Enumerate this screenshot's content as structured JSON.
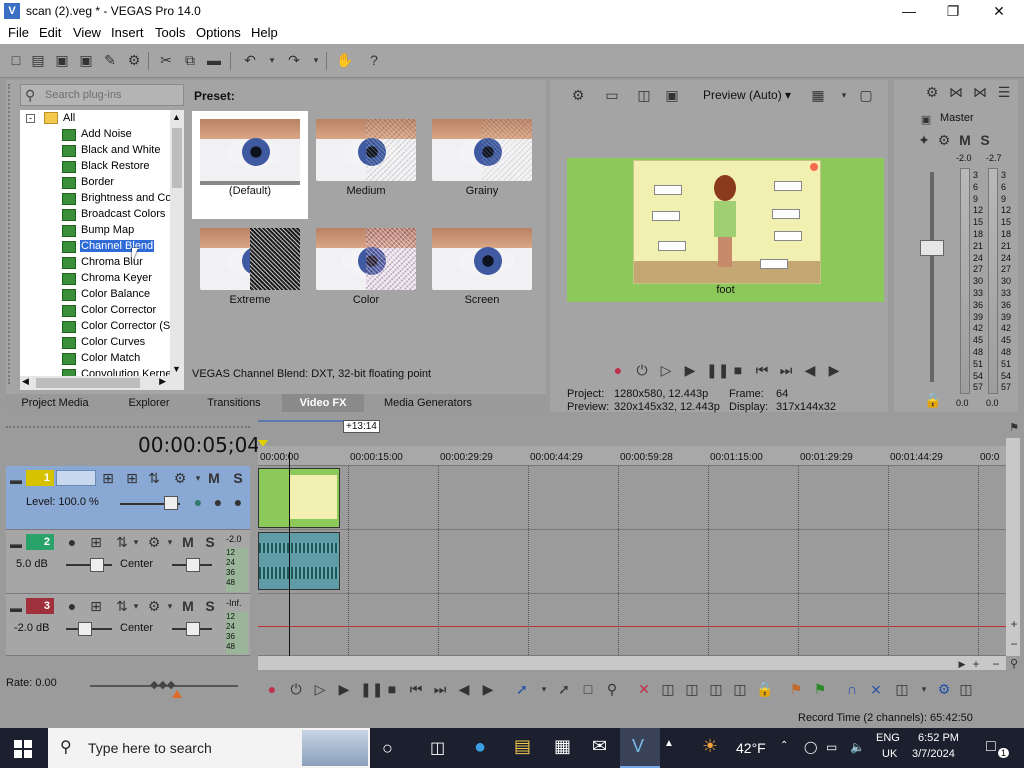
{
  "window": {
    "title": "scan (2).veg * - VEGAS Pro 14.0"
  },
  "menu": [
    "File",
    "Edit",
    "View",
    "Insert",
    "Tools",
    "Options",
    "Help"
  ],
  "plugins": {
    "search_placeholder": "Search plug-ins",
    "root": "All",
    "items": [
      "Add Noise",
      "Black and White",
      "Black Restore",
      "Border",
      "Brightness and Co",
      "Broadcast Colors",
      "Bump Map",
      "Channel Blend",
      "Chroma Blur",
      "Chroma Keyer",
      "Color Balance",
      "Color Corrector",
      "Color Corrector (S",
      "Color Curves",
      "Color Match",
      "Convolution Kerne"
    ],
    "selected": "Channel Blend",
    "preset_label": "Preset:",
    "presets": [
      "(Default)",
      "Medium",
      "Grainy",
      "Extreme",
      "Color",
      "Screen"
    ],
    "status": "VEGAS Channel Blend: DXT, 32-bit floating point",
    "tabs": [
      "Project Media",
      "Explorer",
      "Transitions",
      "Video FX",
      "Media Generators"
    ],
    "active_tab": "Video FX"
  },
  "preview": {
    "quality": "Preview (Auto)",
    "caption": "foot",
    "project_label": "Project:",
    "project_value": "1280x580, 12.443p",
    "preview_label": "Preview:",
    "preview_value": "320x145x32, 12.443p",
    "frame_label": "Frame:",
    "frame_value": "64",
    "display_label": "Display:",
    "display_value": "317x144x32"
  },
  "mixer": {
    "title": "Master",
    "peak_left": "-2.0",
    "peak_right": "-2.7",
    "scale": [
      "3",
      "6",
      "9",
      "12",
      "15",
      "18",
      "21",
      "24",
      "27",
      "30",
      "33",
      "36",
      "39",
      "42",
      "45",
      "48",
      "51",
      "54",
      "57"
    ],
    "level_left": "0.0",
    "level_right": "0.0"
  },
  "timeline": {
    "timecode": "00:00:05;04",
    "playhead_label": "+13:14",
    "ruler": [
      "00:00:00",
      "00:00:15:00",
      "00:00:29:29",
      "00:00:44:29",
      "00:00:59:28",
      "00:01:15:00",
      "00:01:29:29",
      "00:01:44:29",
      "00:0"
    ],
    "tracks": [
      {
        "num": "1",
        "level": "Level: 100.0 %"
      },
      {
        "num": "2",
        "volume": "5.0 dB",
        "pan": "Center",
        "meter_top": "-2.0"
      },
      {
        "num": "3",
        "volume": "-2.0 dB",
        "pan": "Center",
        "meter_top": "-Inf."
      }
    ],
    "meter_scale": [
      "12",
      "24",
      "36",
      "48"
    ],
    "rate": "Rate: 0.00",
    "record_time": "Record Time (2 channels): 65:42:50"
  },
  "taskbar": {
    "search_placeholder": "Type here to search",
    "weather": "42°F",
    "lang_top": "ENG",
    "lang_bottom": "UK",
    "time": "6:52 PM",
    "date": "3/7/2024",
    "notif_count": "1"
  },
  "colors": {
    "accent": "#2f6bd6",
    "preview_bg": "#8dc85b",
    "track1": "#d7c200",
    "track2": "#2aa36b",
    "track3": "#a0303c"
  }
}
